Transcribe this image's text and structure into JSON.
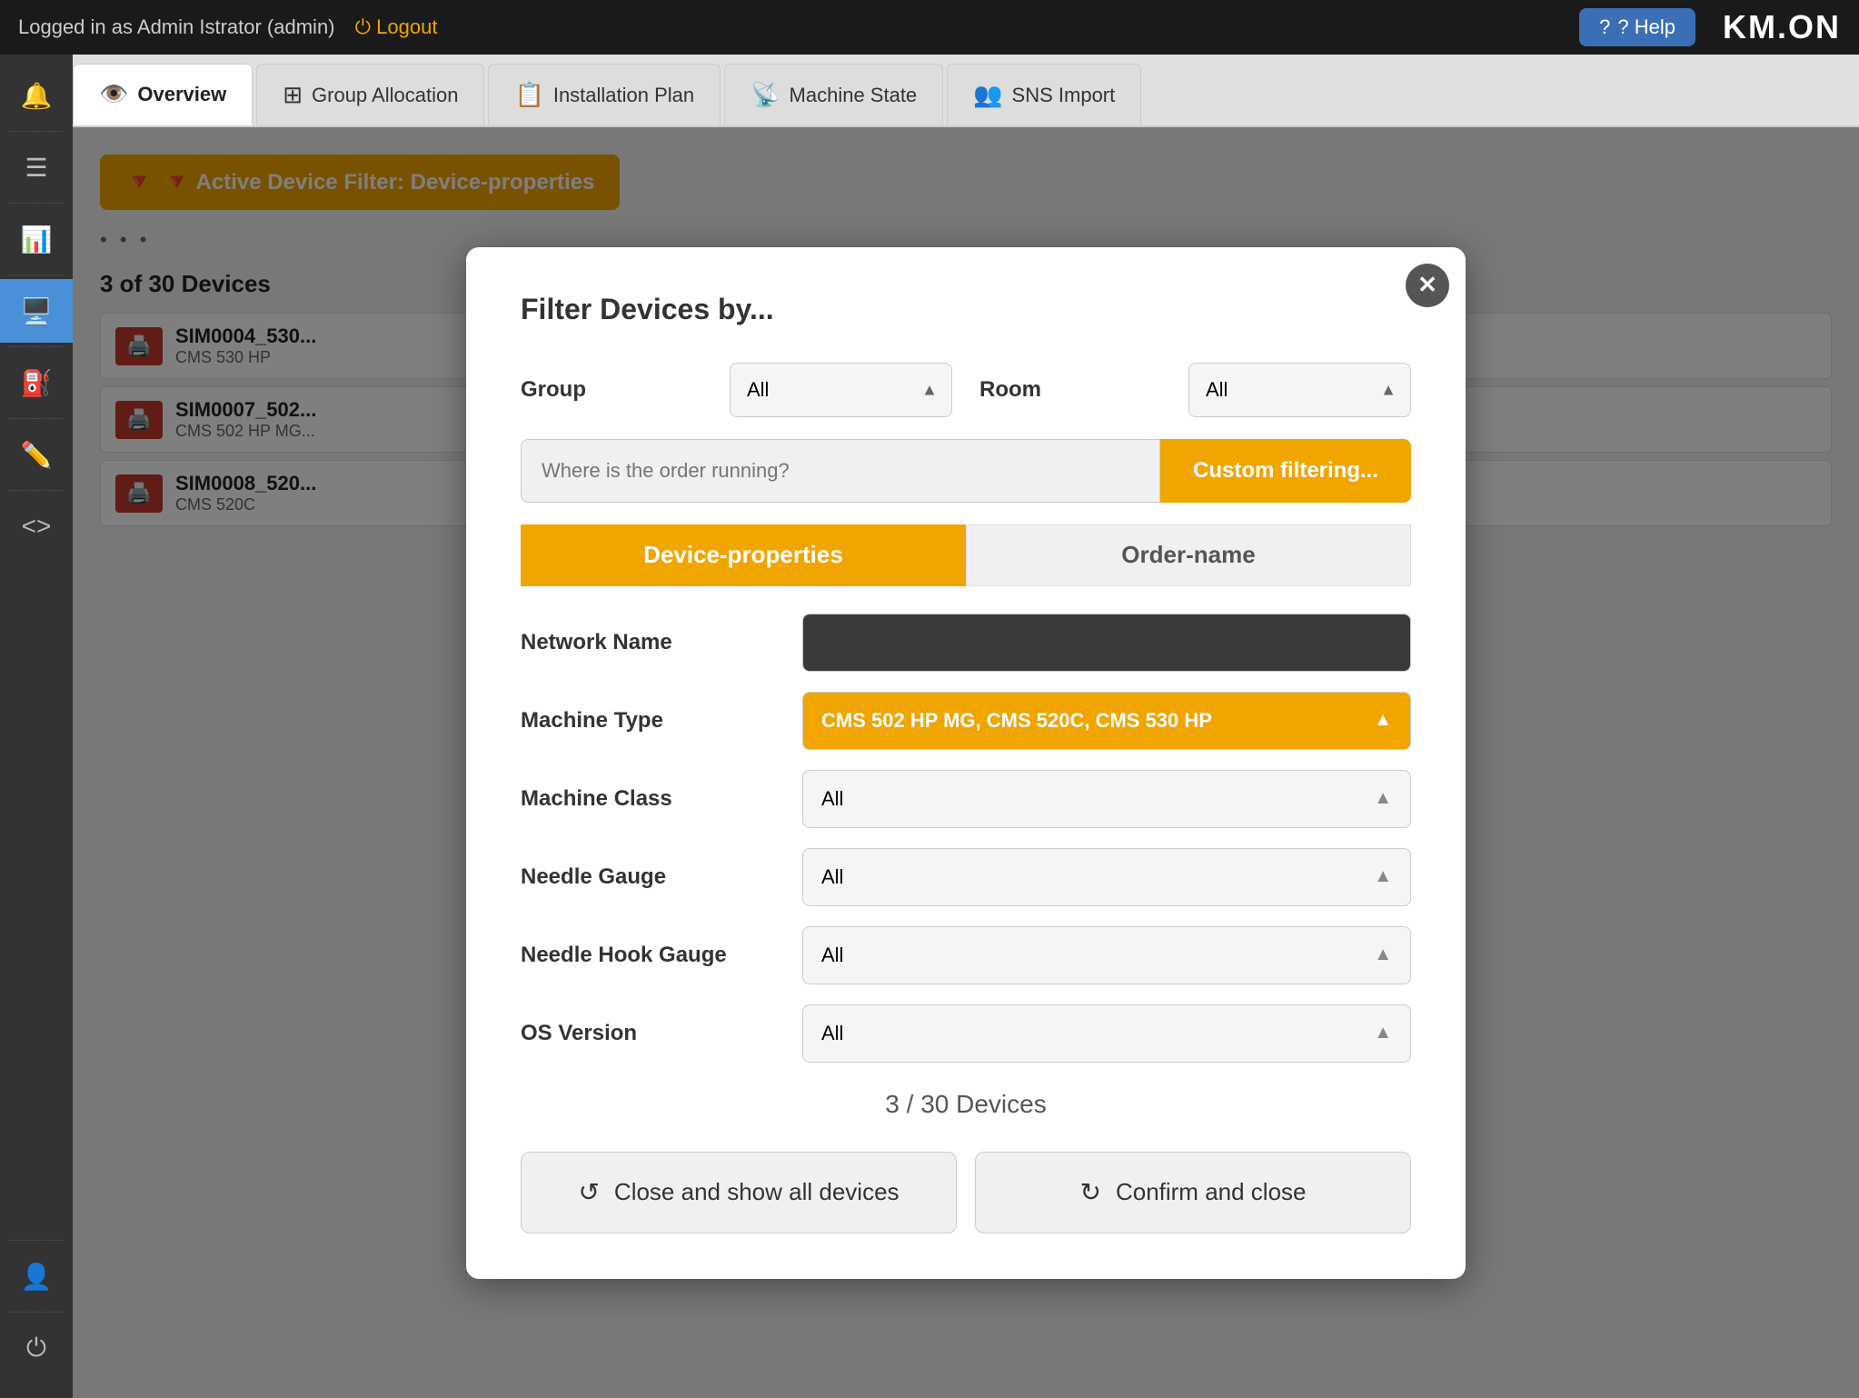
{
  "topbar": {
    "user_text": "Logged in as Admin Istrator (admin)",
    "logout_label": "Logout",
    "help_label": "? Help",
    "logo": "KM.ON"
  },
  "sidebar": {
    "icons": [
      {
        "name": "alert-icon",
        "symbol": "🔔",
        "alert": true
      },
      {
        "name": "list-icon",
        "symbol": "☰"
      },
      {
        "name": "chart-icon",
        "symbol": "📈"
      },
      {
        "name": "screen-icon",
        "symbol": "🖥️",
        "active": true
      },
      {
        "name": "funnel-icon",
        "symbol": "⛽"
      },
      {
        "name": "pen-icon",
        "symbol": "✏️"
      },
      {
        "name": "code-icon",
        "symbol": "<>"
      },
      {
        "name": "person-icon",
        "symbol": "👤"
      },
      {
        "name": "power-icon",
        "symbol": "⏻"
      }
    ]
  },
  "nav_tabs": [
    {
      "id": "overview",
      "label": "Overview",
      "icon": "👁️",
      "active": true
    },
    {
      "id": "group-allocation",
      "label": "Group Allocation",
      "icon": "⊞"
    },
    {
      "id": "installation-plan",
      "label": "Installation Plan",
      "icon": "📋"
    },
    {
      "id": "machine-state",
      "label": "Machine State",
      "icon": "📡"
    },
    {
      "id": "sns-import",
      "label": "SNS Import",
      "icon": "👥"
    }
  ],
  "filter_bar": {
    "label": "🔻 Active Device Filter: Device-properties",
    "dots": "• • •"
  },
  "device_list_header": "3 of 30 Devices",
  "devices": [
    {
      "id": "d1",
      "name": "SIM0004_530...",
      "model": "CMS 530 HP"
    },
    {
      "id": "d2",
      "name": "SIM0007_502...",
      "model": "CMS 502 HP MG..."
    },
    {
      "id": "d3",
      "name": "SIM0008_520...",
      "model": "CMS 520C"
    }
  ],
  "modal": {
    "title": "Filter Devices by...",
    "group_label": "Group",
    "group_value": "All",
    "room_label": "Room",
    "room_value": "All",
    "search_placeholder": "Where is the order running?",
    "custom_filter_label": "Custom filtering...",
    "tab_device_properties": "Device-properties",
    "tab_order_name": "Order-name",
    "fields": [
      {
        "id": "network-name",
        "label": "Network Name",
        "value": "",
        "style": "dark"
      },
      {
        "id": "machine-type",
        "label": "Machine Type",
        "value": "CMS 502 HP MG, CMS 520C, CMS 530 HP",
        "style": "amber"
      },
      {
        "id": "machine-class",
        "label": "Machine Class",
        "value": "All",
        "style": "normal"
      },
      {
        "id": "needle-gauge",
        "label": "Needle Gauge",
        "value": "All",
        "style": "normal"
      },
      {
        "id": "needle-hook-gauge",
        "label": "Needle Hook Gauge",
        "value": "All",
        "style": "normal"
      },
      {
        "id": "os-version",
        "label": "OS Version",
        "value": "All",
        "style": "normal"
      }
    ],
    "device_summary": "3 / 30 Devices",
    "close_all_label": "Close and show all devices",
    "confirm_label": "Confirm and close"
  }
}
